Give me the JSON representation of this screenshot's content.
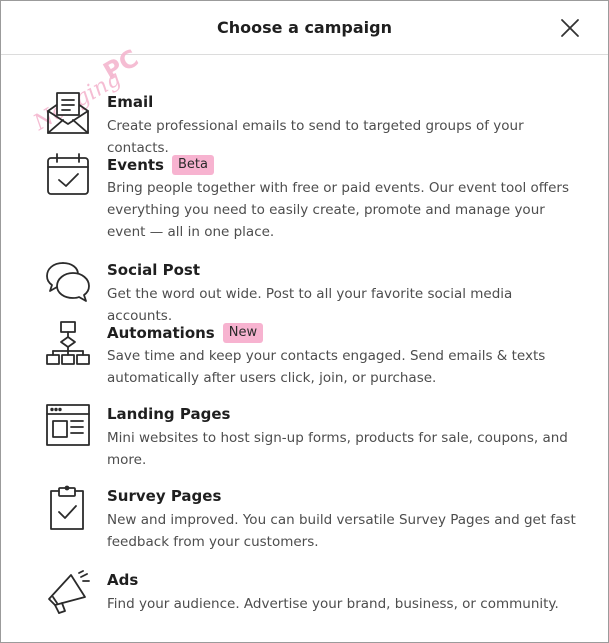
{
  "header": {
    "title": "Choose a campaign"
  },
  "watermark": {
    "text_script": "Nonging",
    "text_bold": "PC",
    "color": "#f4b6cf"
  },
  "items": [
    {
      "title": "Email",
      "badge": "",
      "description": "Create professional emails to send to targeted groups of your contacts.",
      "icon": "email-icon"
    },
    {
      "title": "Events",
      "badge": "Beta",
      "description": "Bring people together with free or paid events. Our event tool offers everything you need to easily create, promote and manage your event — all in one place.",
      "icon": "calendar-check-icon"
    },
    {
      "title": "Social Post",
      "badge": "",
      "description": "Get the word out wide. Post to all your favorite social media accounts.",
      "icon": "chat-bubbles-icon"
    },
    {
      "title": "Automations",
      "badge": "New",
      "description": "Save time and keep your contacts engaged. Send emails & texts automatically after users click, join, or purchase.",
      "icon": "flowchart-icon"
    },
    {
      "title": "Landing Pages",
      "badge": "",
      "description": "Mini websites to host sign-up forms, products for sale, coupons, and more.",
      "icon": "browser-page-icon"
    },
    {
      "title": "Survey Pages",
      "badge": "",
      "description": "New and improved. You can build versatile Survey Pages and get fast feedback from your customers.",
      "icon": "clipboard-check-icon"
    },
    {
      "title": "Ads",
      "badge": "",
      "description": "Find your audience. Advertise your brand, business, or community.",
      "icon": "megaphone-icon"
    }
  ],
  "colors": {
    "badge": "#f7b3d0",
    "text": "#2b2b2b",
    "muted": "#4d4d4d",
    "border": "#9b9b9b"
  }
}
